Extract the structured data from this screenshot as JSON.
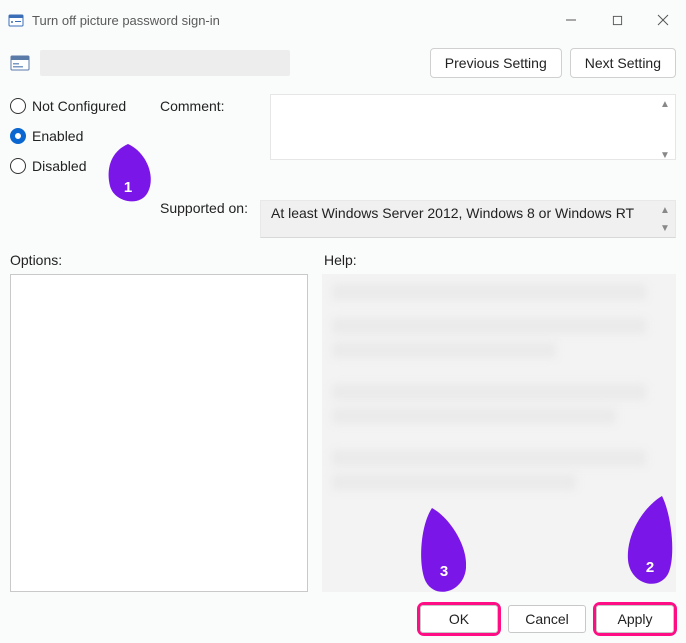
{
  "window": {
    "title": "Turn off picture password sign-in"
  },
  "nav": {
    "prev": "Previous Setting",
    "next": "Next Setting"
  },
  "radios": {
    "not_configured": "Not Configured",
    "enabled": "Enabled",
    "disabled": "Disabled",
    "selected": "enabled"
  },
  "labels": {
    "comment": "Comment:",
    "supported_on": "Supported on:",
    "options": "Options:",
    "help": "Help:"
  },
  "fields": {
    "comment_value": "",
    "supported_value": "At least Windows Server 2012, Windows 8 or Windows RT"
  },
  "buttons": {
    "ok": "OK",
    "cancel": "Cancel",
    "apply": "Apply"
  },
  "annotations": {
    "p1": "1",
    "p2": "2",
    "p3": "3"
  }
}
